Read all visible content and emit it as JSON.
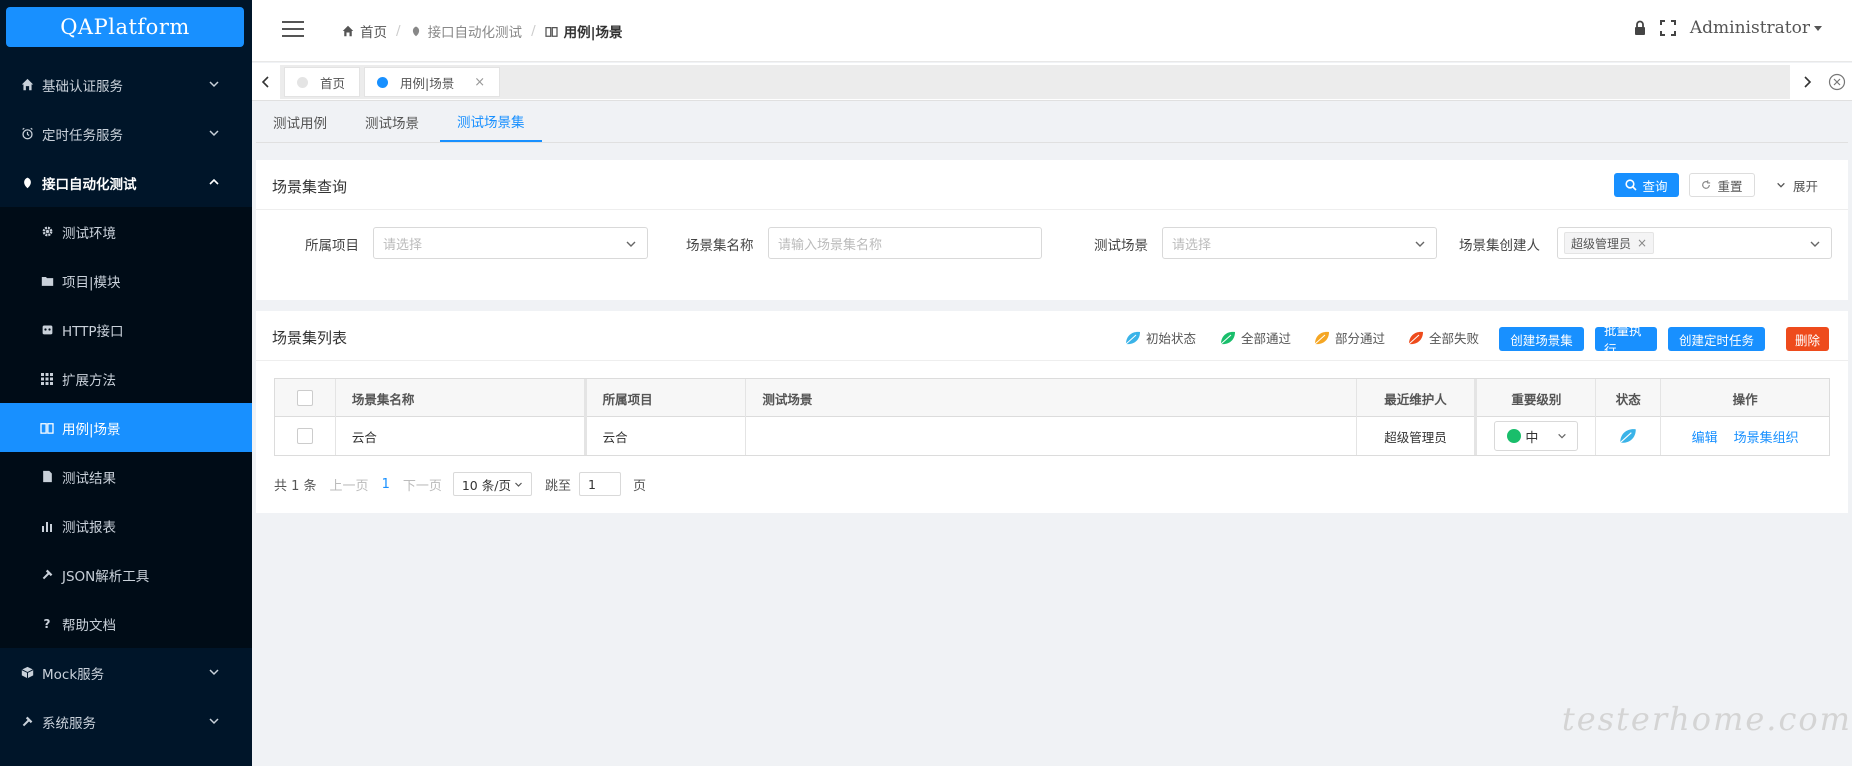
{
  "app": {
    "logo": "QAPlatform"
  },
  "sidebar": {
    "items": [
      {
        "label": "基础认证服务",
        "icon": "home-icon"
      },
      {
        "label": "定时任务服务",
        "icon": "alarm-clock-icon"
      },
      {
        "label": "接口自动化测试",
        "icon": "leaf-icon"
      },
      {
        "label": "Mock服务",
        "icon": "cube-icon"
      },
      {
        "label": "系统服务",
        "icon": "wrench-icon"
      }
    ],
    "sub_items": [
      {
        "label": "测试环境",
        "icon": "gear-icon"
      },
      {
        "label": "项目|模块",
        "icon": "folder-icon"
      },
      {
        "label": "HTTP接口",
        "icon": "robot-icon"
      },
      {
        "label": "扩展方法",
        "icon": "grid-icon"
      },
      {
        "label": "用例|场景",
        "icon": "book-icon"
      },
      {
        "label": "测试结果",
        "icon": "document-icon"
      },
      {
        "label": "测试报表",
        "icon": "bar-chart-icon"
      },
      {
        "label": "JSON解析工具",
        "icon": "hammer-icon"
      },
      {
        "label": "帮助文档",
        "icon": "question-icon"
      }
    ]
  },
  "header": {
    "breadcrumb": [
      "首页",
      "接口自动化测试",
      "用例|场景"
    ],
    "user": "Administrator"
  },
  "tabbar": {
    "tabs": [
      {
        "label": "首页",
        "dot_color": "#e4e4e4"
      },
      {
        "label": "用例|场景",
        "dot_color": "#1890ff"
      }
    ],
    "close_symbol": "×"
  },
  "subtabs": [
    "测试用例",
    "测试场景",
    "测试场景集"
  ],
  "query_panel": {
    "title": "场景集查询",
    "search_label": "查询",
    "reset_label": "重置",
    "expand_label": "展开",
    "fields": {
      "project_label": "所属项目",
      "project_placeholder": "请选择",
      "name_label": "场景集名称",
      "name_placeholder": "请输入场景集名称",
      "scene_label": "测试场景",
      "scene_placeholder": "请选择",
      "creator_label": "场景集创建人",
      "creator_tag": "超级管理员",
      "tag_close": "×"
    }
  },
  "list_panel": {
    "title": "场景集列表",
    "legend": [
      {
        "label": "初始状态",
        "color": "#3ab3e8"
      },
      {
        "label": "全部通过",
        "color": "#19be6b"
      },
      {
        "label": "部分通过",
        "color": "#f5a623"
      },
      {
        "label": "全部失败",
        "color": "#ee4b1c"
      }
    ],
    "buttons": {
      "create": "创建场景集",
      "batch_run": "批量执行",
      "create_timer": "创建定时任务",
      "delete": "删除"
    },
    "columns": [
      "场景集名称",
      "所属项目",
      "测试场景",
      "最近维护人",
      "重要级别",
      "状态",
      "操作"
    ],
    "rows": [
      {
        "name": "云合",
        "project": "云合",
        "scene": "",
        "maintainer": "超级管理员",
        "level": "中",
        "status_color": "#3ab3e8",
        "actions": [
          "编辑",
          "场景集组织"
        ]
      }
    ],
    "pager": {
      "total": "共 1 条",
      "prev": "上一页",
      "page": "1",
      "next": "下一页",
      "page_size": "10 条/页",
      "goto_label": "跳至",
      "goto_value": "1",
      "page_unit": "页"
    }
  },
  "watermark": "testerhome.com"
}
